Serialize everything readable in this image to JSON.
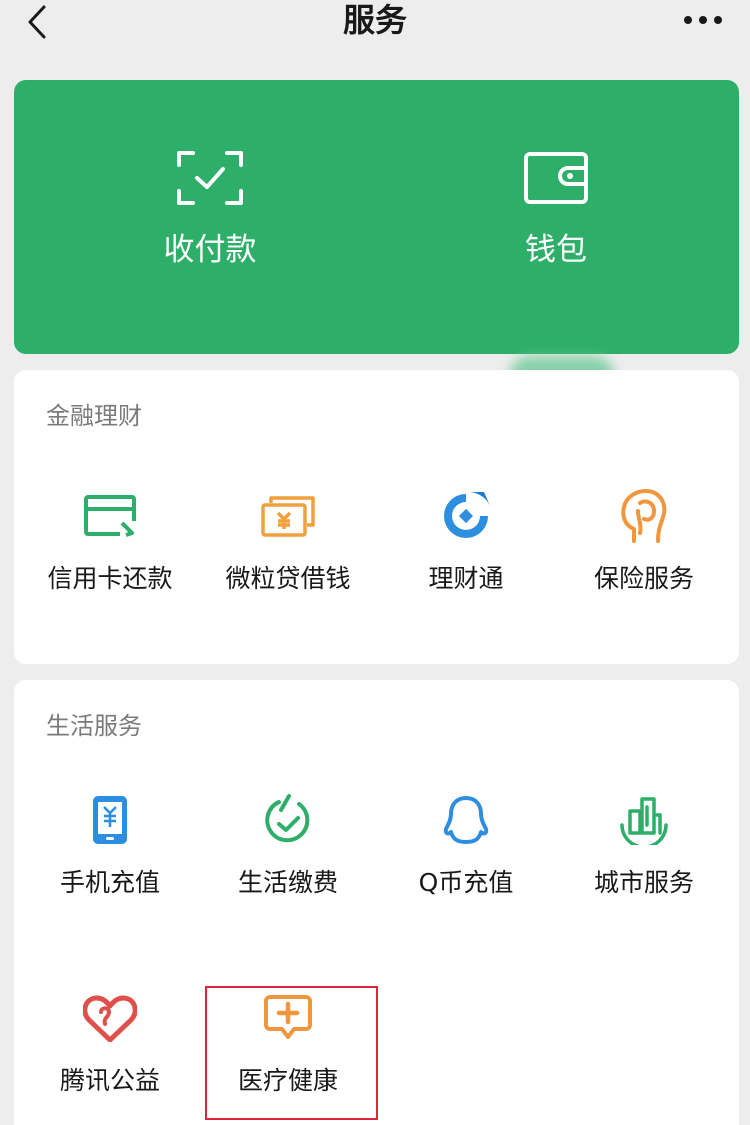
{
  "header": {
    "title": "服务",
    "back_icon": "chevron-left-icon",
    "more_icon": "more-dots-icon"
  },
  "top_card": {
    "bg_color": "#2dae69",
    "items": [
      {
        "label": "收付款",
        "icon": "scan-check-icon"
      },
      {
        "label": "钱包",
        "icon": "wallet-icon"
      }
    ]
  },
  "finance": {
    "title": "金融理财",
    "items": [
      {
        "label": "信用卡还款",
        "icon": "credit-card-icon",
        "color": "#2dae69"
      },
      {
        "label": "微粒贷借钱",
        "icon": "cash-icon",
        "color": "#f0a03c"
      },
      {
        "label": "理财通",
        "icon": "wealth-icon",
        "color": "#2d8ee0"
      },
      {
        "label": "保险服务",
        "icon": "insurance-icon",
        "color": "#f0963c"
      }
    ]
  },
  "life": {
    "title": "生活服务",
    "items": [
      {
        "label": "手机充值",
        "icon": "phone-recharge-icon",
        "color": "#2d8ee0"
      },
      {
        "label": "生活缴费",
        "icon": "utility-icon",
        "color": "#2dae69"
      },
      {
        "label": "Q币充值",
        "icon": "qq-icon",
        "color": "#2d8ee0"
      },
      {
        "label": "城市服务",
        "icon": "city-icon",
        "color": "#2dae69"
      },
      {
        "label": "腾讯公益",
        "icon": "charity-heart-icon",
        "color": "#e0504b"
      },
      {
        "label": "医疗健康",
        "icon": "medical-icon",
        "color": "#f0963c"
      }
    ]
  }
}
